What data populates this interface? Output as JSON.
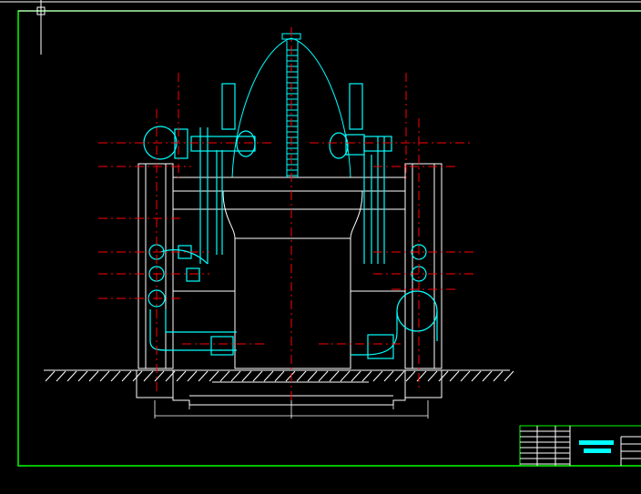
{
  "canvas": {
    "background": "#000000"
  },
  "colors": {
    "border": "#00ff00",
    "equipment": "#00ffff",
    "structure": "#ffffff",
    "centerline": "#ff0000",
    "title_text": "#00ffff"
  },
  "icons": {
    "cursor": "crosshair-cursor-icon"
  }
}
